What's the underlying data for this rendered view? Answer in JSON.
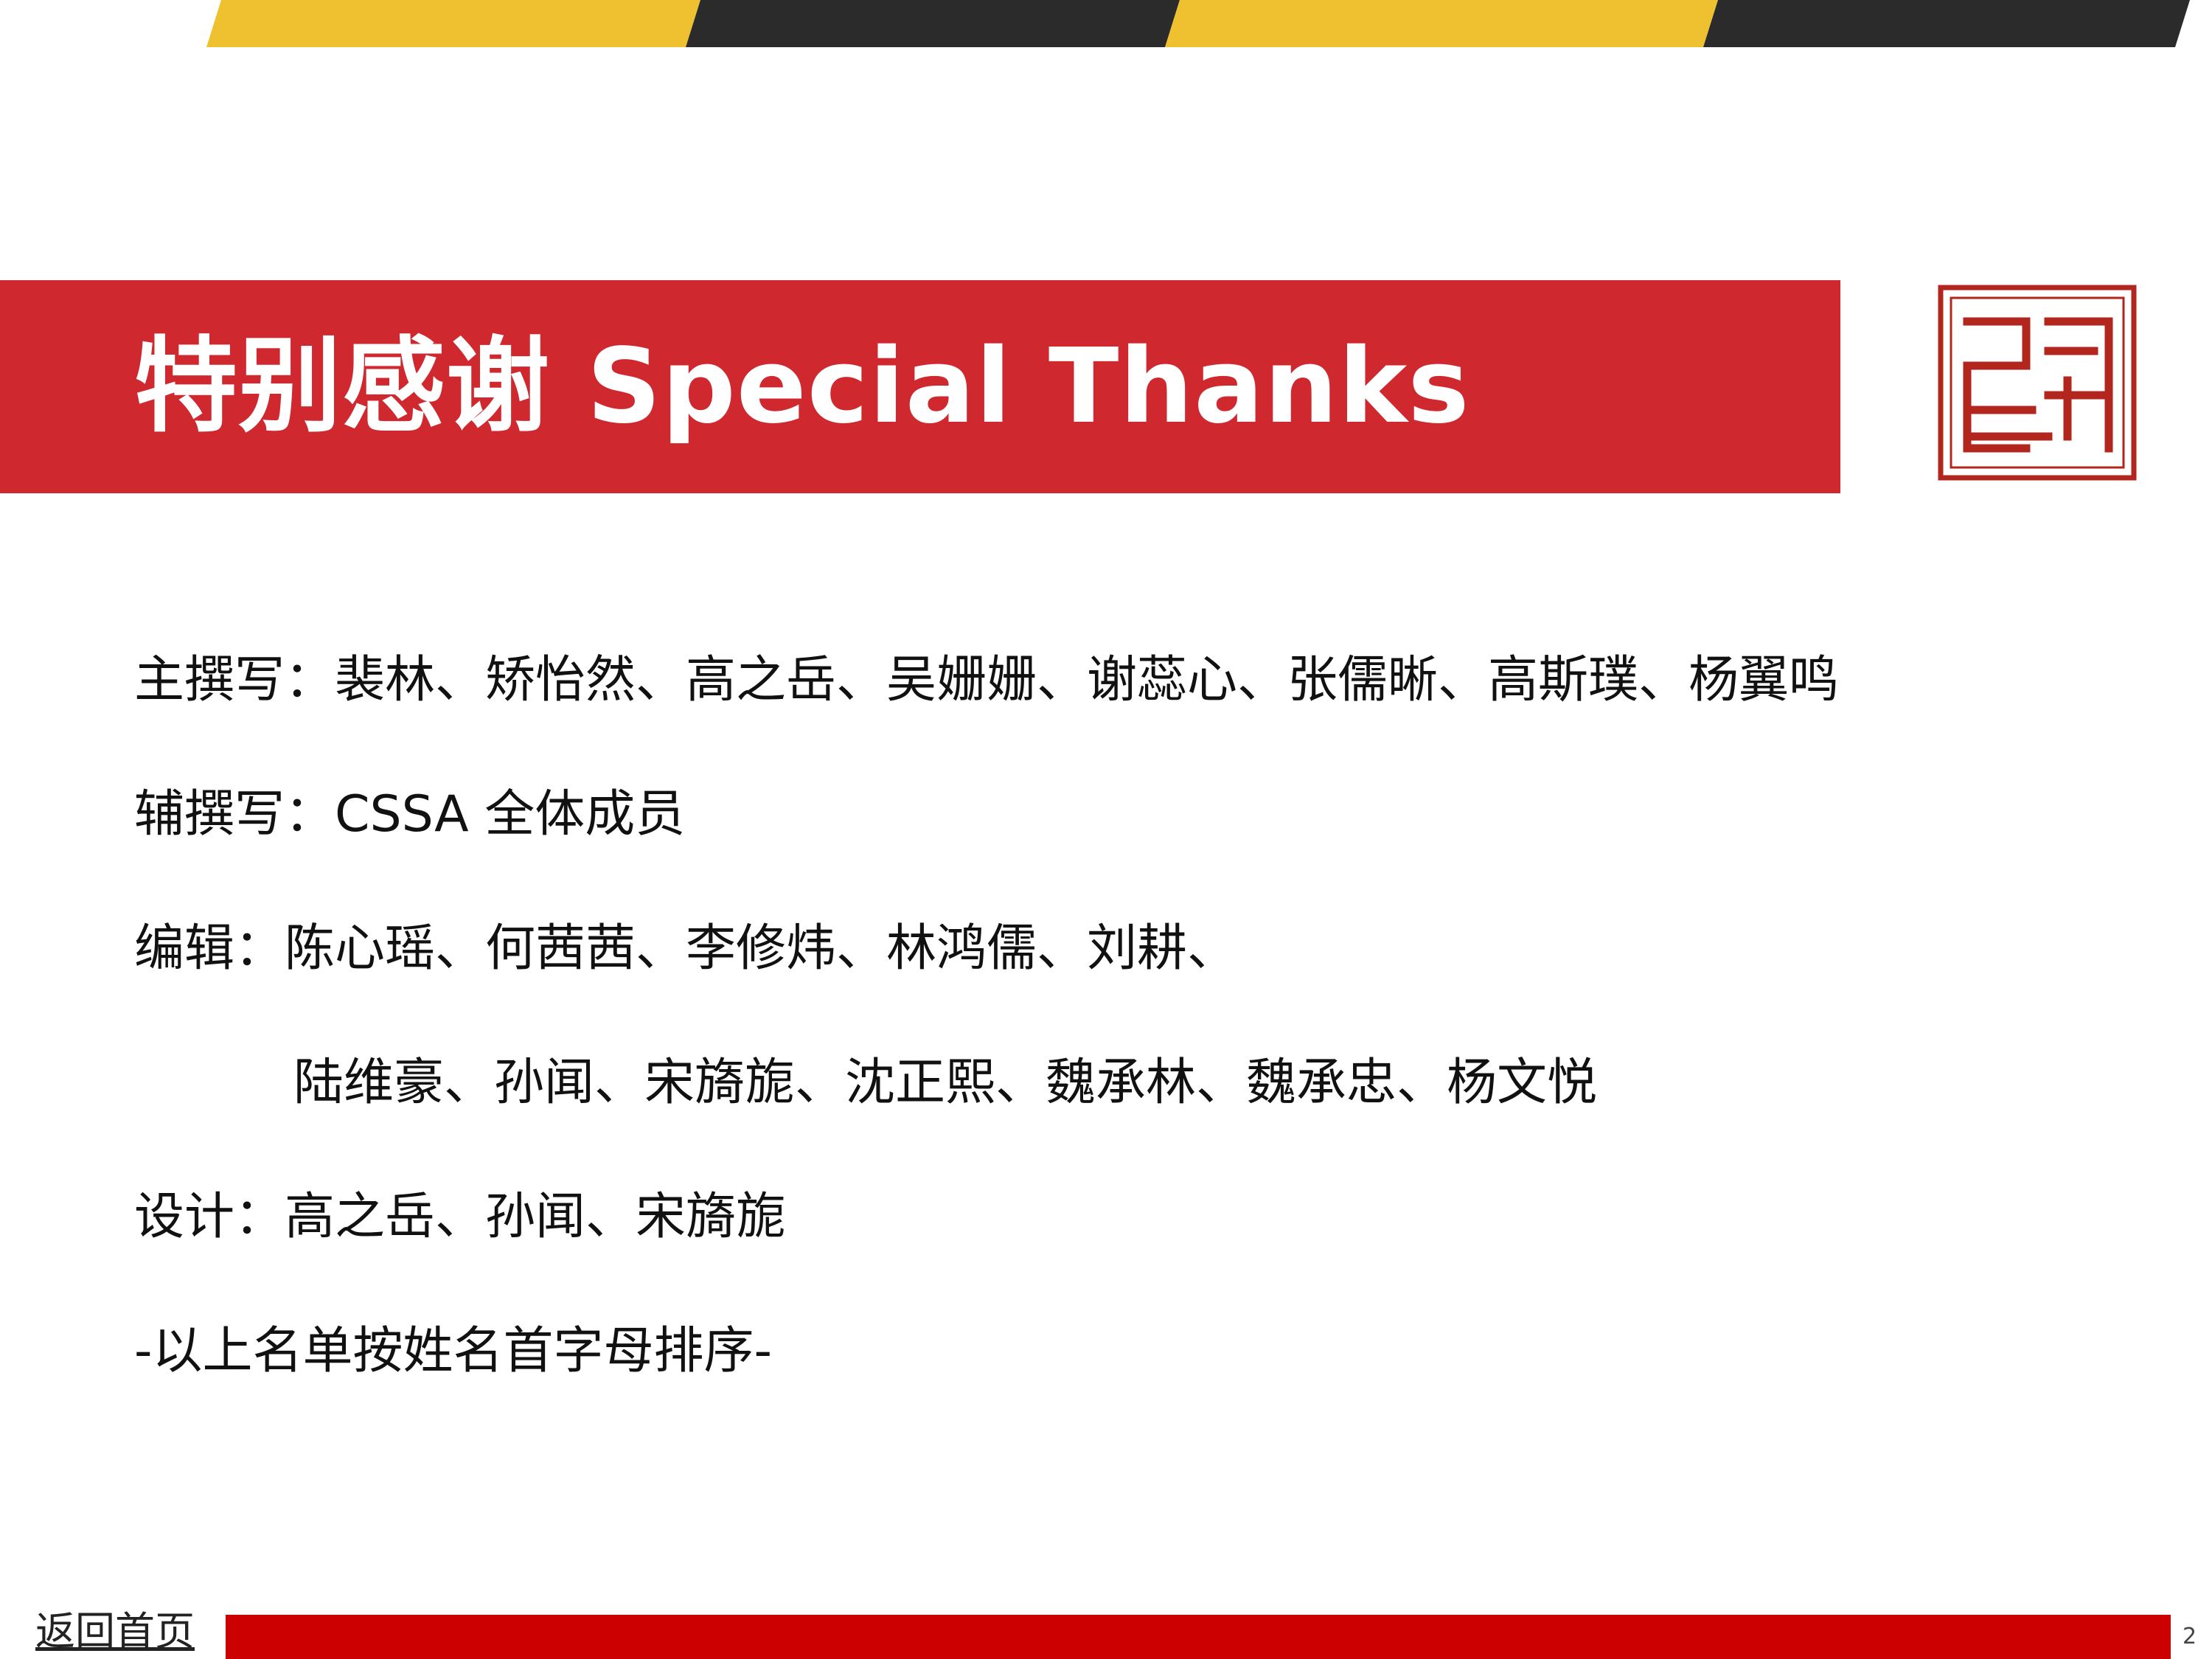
{
  "colors": {
    "accent_red": "#d0282f",
    "footer_red": "#cc0000",
    "stripe_yellow": "#efc130",
    "stripe_dark": "#2b2b2b"
  },
  "title": "特别感谢 Special Thanks",
  "credits": {
    "main_writers": "主撰写：裴林、矫怡然、高之岳、吴姗姗、谢蕊心、张儒晰、高斯璞、杨翼鸣",
    "assistant_writers": "辅撰写：CSSA 全体成员",
    "editors_line1": "编辑：陈心瑶、何茜茜、李修炜、林鸿儒、刘耕、",
    "editors_line2": "陆维豪、孙闻、宋旖旎、沈正熙、魏承林、魏承忠、杨文悦",
    "design": "设计：高之岳、孙闻、宋旖旎",
    "note": "-以上名单按姓名首字母排序-"
  },
  "footer": {
    "home_link": "返回首页",
    "page_number": "2"
  },
  "icons": {
    "seal": "seal-logo-icon"
  }
}
